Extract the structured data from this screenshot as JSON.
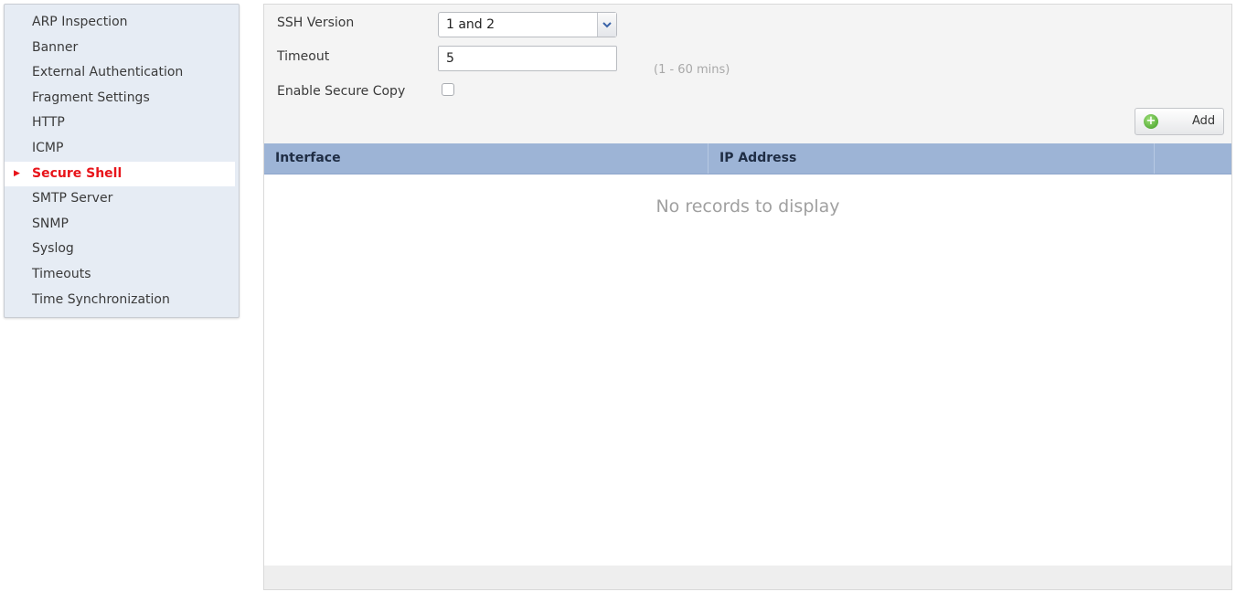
{
  "sidebar": {
    "items": [
      {
        "label": "ARP Inspection"
      },
      {
        "label": "Banner"
      },
      {
        "label": "External Authentication"
      },
      {
        "label": "Fragment Settings"
      },
      {
        "label": "HTTP"
      },
      {
        "label": "ICMP"
      },
      {
        "label": "Secure Shell",
        "active": true
      },
      {
        "label": "SMTP Server"
      },
      {
        "label": "SNMP"
      },
      {
        "label": "Syslog"
      },
      {
        "label": "Timeouts"
      },
      {
        "label": "Time Synchronization"
      }
    ],
    "active_indicator": "▶"
  },
  "form": {
    "ssh_version_label": "SSH Version",
    "ssh_version_value": "1 and 2",
    "timeout_label": "Timeout",
    "timeout_value": "5",
    "timeout_hint": "(1 - 60 mins)",
    "secure_copy_label": "Enable Secure Copy",
    "secure_copy_checked": false
  },
  "toolbar": {
    "add_label": "Add"
  },
  "table": {
    "columns": [
      "Interface",
      "IP Address"
    ],
    "rows": [],
    "empty_message": "No records to display"
  },
  "colors": {
    "accent_red": "#e8141a",
    "header_blue": "#9db4d6",
    "sidebar_bg": "#e6ecf4",
    "add_icon_green": "#3e9b22"
  },
  "icons": {
    "dropdown": "chevron-down-icon",
    "add": "add-circle-icon",
    "active": "triangle-right-icon"
  }
}
